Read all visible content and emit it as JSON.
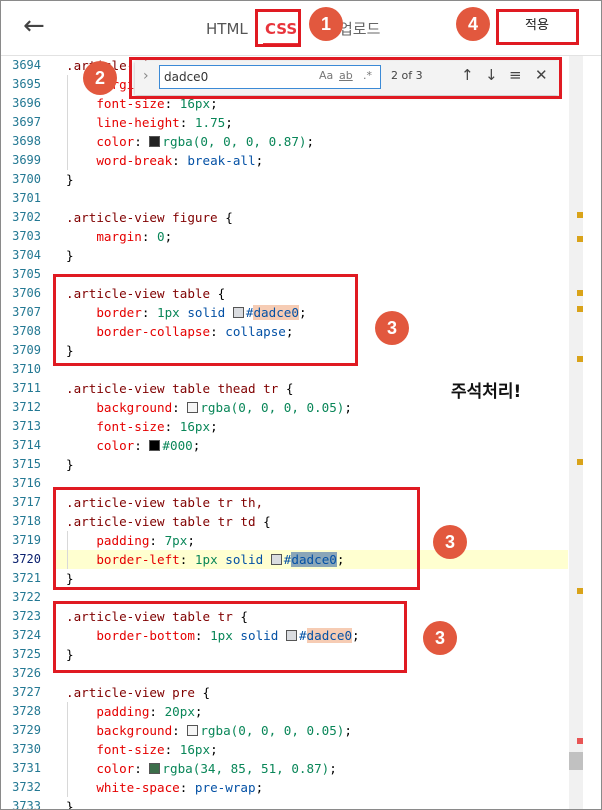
{
  "header": {
    "back_icon": "arrow-left-icon",
    "tabs": [
      {
        "label": "HTML"
      },
      {
        "label": "CSS",
        "active": true
      },
      {
        "label": "업로드"
      }
    ],
    "apply_label": "적용",
    "accent_color": "#e8343c"
  },
  "find_widget": {
    "query": "dadce0",
    "match_case": "Aa",
    "whole_word": "ab",
    "regex": ".*",
    "count": "2 of 3",
    "prev_icon": "arrow-up-icon",
    "next_icon": "arrow-down-icon",
    "selection_icon": "find-in-selection-icon",
    "close_icon": "close-icon"
  },
  "annotations": {
    "badges": [
      "1",
      "2",
      "3",
      "3",
      "3",
      "4"
    ],
    "note": "주석처리!",
    "box_color": "#e01a22",
    "badge_color": "#e2583e"
  },
  "editor": {
    "active_line": "3720",
    "lines": [
      {
        "n": "3694",
        "t": ".article-view"
      },
      {
        "n": "3695",
        "t": "    margin"
      },
      {
        "n": "3696",
        "t": "    font-size: 16px;"
      },
      {
        "n": "3697",
        "t": "    line-height: 1.75;"
      },
      {
        "n": "3698",
        "t": "    color: rgba(0, 0, 0, 0.87);"
      },
      {
        "n": "3699",
        "t": "    word-break: break-all;"
      },
      {
        "n": "3700",
        "t": "}"
      },
      {
        "n": "3701",
        "t": ""
      },
      {
        "n": "3702",
        "t": ".article-view figure {"
      },
      {
        "n": "3703",
        "t": "    margin: 0;"
      },
      {
        "n": "3704",
        "t": "}"
      },
      {
        "n": "3705",
        "t": ""
      },
      {
        "n": "3706",
        "t": ".article-view table {"
      },
      {
        "n": "3707",
        "t": "    border: 1px solid #dadce0;"
      },
      {
        "n": "3708",
        "t": "    border-collapse: collapse;"
      },
      {
        "n": "3709",
        "t": "}"
      },
      {
        "n": "3710",
        "t": ""
      },
      {
        "n": "3711",
        "t": ".article-view table thead tr {"
      },
      {
        "n": "3712",
        "t": "    background: rgba(0, 0, 0, 0.05);"
      },
      {
        "n": "3713",
        "t": "    font-size: 16px;"
      },
      {
        "n": "3714",
        "t": "    color: #000;"
      },
      {
        "n": "3715",
        "t": "}"
      },
      {
        "n": "3716",
        "t": ""
      },
      {
        "n": "3717",
        "t": ".article-view table tr th,"
      },
      {
        "n": "3718",
        "t": ".article-view table tr td {"
      },
      {
        "n": "3719",
        "t": "    padding: 7px;"
      },
      {
        "n": "3720",
        "t": "    border-left: 1px solid #dadce0;"
      },
      {
        "n": "3721",
        "t": "}"
      },
      {
        "n": "3722",
        "t": ""
      },
      {
        "n": "3723",
        "t": ".article-view table tr {"
      },
      {
        "n": "3724",
        "t": "    border-bottom: 1px solid #dadce0;"
      },
      {
        "n": "3725",
        "t": "}"
      },
      {
        "n": "3726",
        "t": ""
      },
      {
        "n": "3727",
        "t": ".article-view pre {"
      },
      {
        "n": "3728",
        "t": "    padding: 20px;"
      },
      {
        "n": "3729",
        "t": "    background: rgba(0, 0, 0, 0.05);"
      },
      {
        "n": "3730",
        "t": "    font-size: 16px;"
      },
      {
        "n": "3731",
        "t": "    color: rgba(34, 85, 51, 0.87);"
      },
      {
        "n": "3732",
        "t": "    white-space: pre-wrap;"
      },
      {
        "n": "3733",
        "t": "}"
      }
    ]
  }
}
